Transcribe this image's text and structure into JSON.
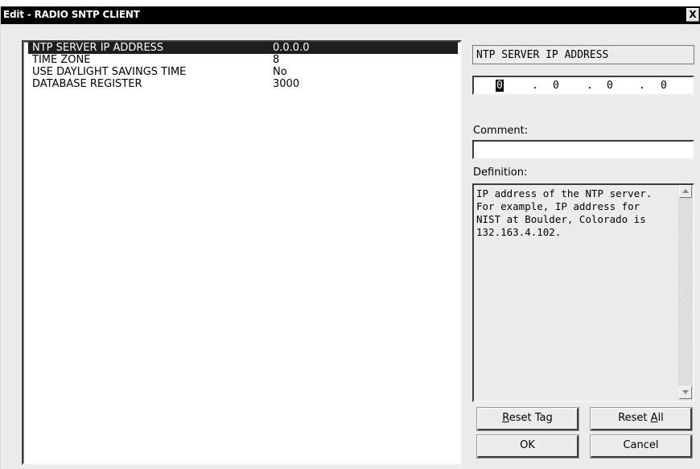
{
  "window": {
    "title": "Edit - RADIO SNTP CLIENT",
    "close_label": "X"
  },
  "list": {
    "rows": [
      {
        "name": "NTP SERVER IP ADDRESS",
        "value": "0.0.0.0",
        "selected": true
      },
      {
        "name": "TIME ZONE",
        "value": "8",
        "selected": false
      },
      {
        "name": "USE DAYLIGHT SAVINGS TIME",
        "value": "No",
        "selected": false
      },
      {
        "name": "DATABASE REGISTER",
        "value": "3000",
        "selected": false
      }
    ]
  },
  "editor": {
    "field_caption": "NTP SERVER IP ADDRESS",
    "ip_octets": [
      "0",
      "0",
      "0",
      "0"
    ],
    "ip_separator": ".",
    "comment_label": "Comment:",
    "comment_value": "",
    "definition_label": "Definition:",
    "definition_text": "IP address of the NTP server.\nFor example, IP address for\nNIST at Boulder, Colorado is\n132.163.4.102."
  },
  "buttons": {
    "reset_tag": {
      "underline": "R",
      "rest": "eset Tag"
    },
    "reset_all": {
      "prefix": "Reset ",
      "underline": "A",
      "rest": "ll"
    },
    "ok": "OK",
    "cancel": "Cancel"
  },
  "icons": {
    "scroll_up": "scroll-up-arrow-icon",
    "scroll_down": "scroll-down-arrow-icon"
  }
}
